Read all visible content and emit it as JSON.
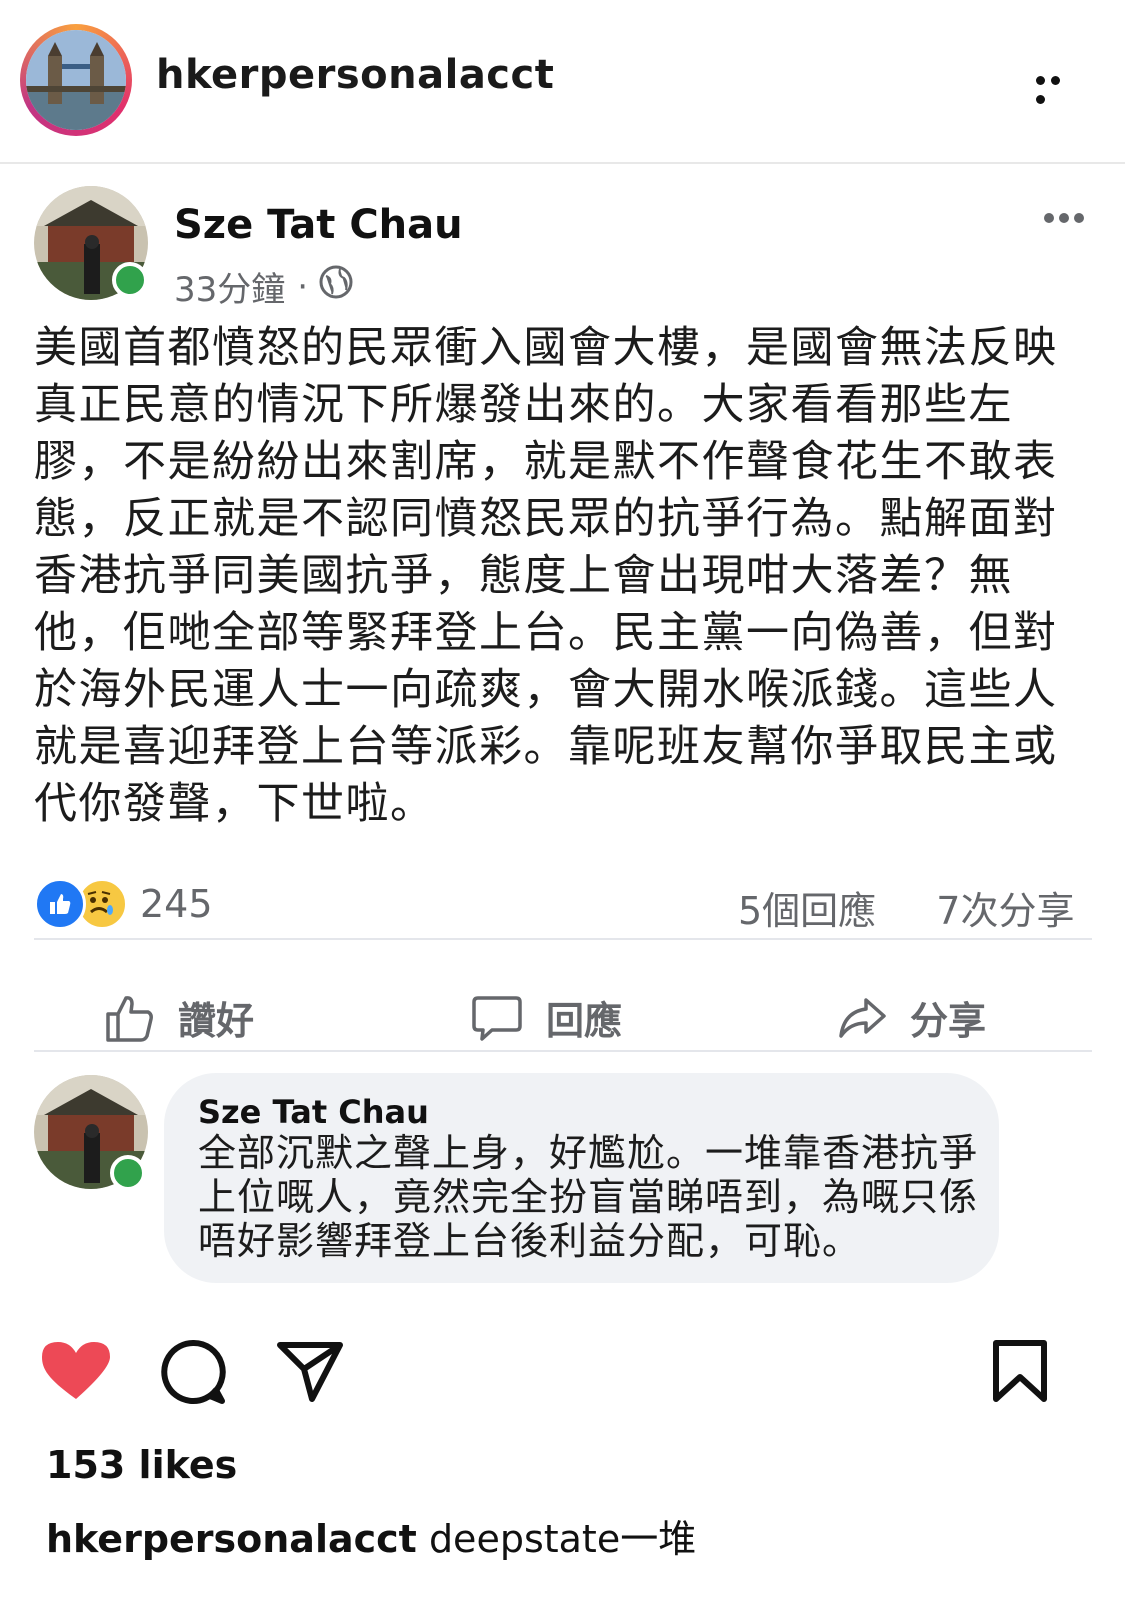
{
  "ig": {
    "username": "hkerpersonalacct",
    "likes": "153 likes",
    "caption_user": "hkerpersonalacct",
    "caption_text": "deepstate一堆",
    "icons": [
      "heart-icon",
      "comment-icon",
      "share-icon",
      "bookmark-icon",
      "more-icon"
    ],
    "heart_color": "#ed4956"
  },
  "post": {
    "author": "Sze Tat Chau",
    "time": "33分鐘",
    "separator": "·",
    "body": "美國首都憤怒的民眾衝入國會大樓，是國會無法反映真正民意的情況下所爆發出來的。大家看看那些左膠，不是紛紛出來割席，就是默不作聲食花生不敢表態，反正就是不認同憤怒民眾的抗爭行為。點解面對香港抗爭同美國抗爭，態度上會出現咁大落差？無他，佢哋全部等緊拜登上台。民主黨一向偽善，但對於海外民運人士一向疏爽，會大開水喉派錢。這些人就是喜迎拜登上台等派彩。靠呢班友幫你爭取民主或代你發聲，下世啦。",
    "reaction_count": "245",
    "comments_count": "5個回應",
    "shares_count": "7次分享",
    "like_label": "讚好",
    "comment_label": "回應",
    "share_label": "分享",
    "accent": "#2078f4",
    "online_color": "#31a24c"
  },
  "comment": {
    "author": "Sze Tat Chau",
    "text": "全部沉默之聲上身，好尷尬。一堆靠香港抗爭上位嘅人，竟然完全扮盲當睇唔到，為嘅只係唔好影響拜登上台後利益分配，可恥。"
  }
}
